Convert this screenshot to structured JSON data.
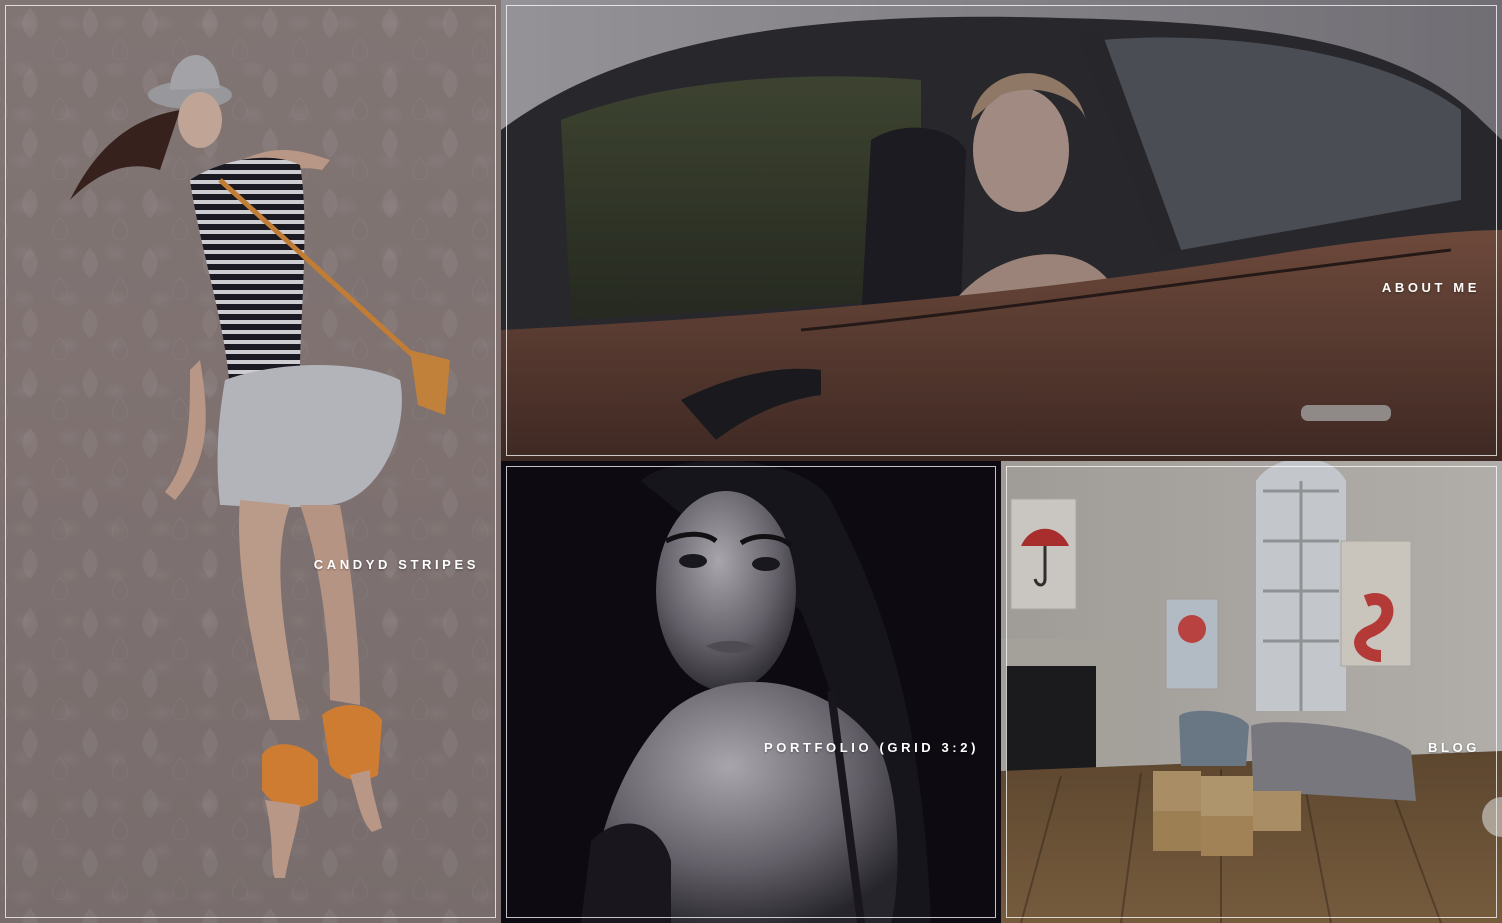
{
  "tiles": {
    "candyd": {
      "label": "CANDYD STRIPES"
    },
    "about": {
      "label": "ABOUT ME"
    },
    "portfolio": {
      "label": "PORTFOLIO (GRID 3:2)"
    },
    "blog": {
      "label": "BLOG"
    }
  },
  "colors": {
    "frame": "#ffffff",
    "label": "#ffffff",
    "overlay": "#1c1a22"
  }
}
